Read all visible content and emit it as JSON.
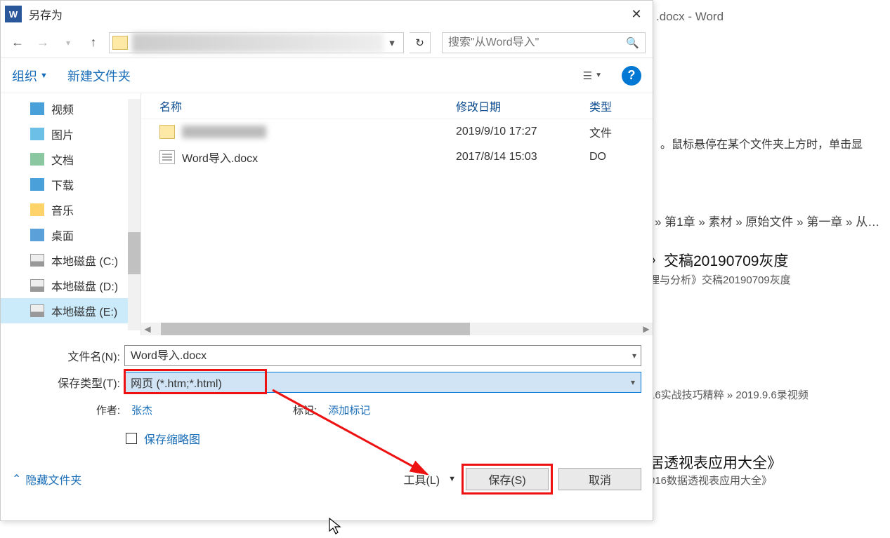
{
  "bg": {
    "winTitle": ".docx  -  Word",
    "hint": "。鼠标悬停在某个文件夹上方时，单击显",
    "path1": "» 第1章 » 素材 » 原始文件 » 第一章 » 从…",
    "head1": "〉交稿20190709灰度",
    "sub1": "理与分析》交稿20190709灰度",
    "path2": "16实战技巧精粹 » 2019.9.6录视频",
    "head2": "居透视表应用大全》",
    "sub2": "016数据透视表应用大全》"
  },
  "dialog": {
    "title": "另存为",
    "organize": "组织",
    "newFolder": "新建文件夹",
    "searchPlaceholder": "搜索\"从Word导入\"",
    "columns": {
      "name": "名称",
      "modified": "修改日期",
      "type": "类型"
    },
    "sidebar": [
      "视频",
      "图片",
      "文档",
      "下载",
      "音乐",
      "桌面",
      "本地磁盘 (C:)",
      "本地磁盘 (D:)",
      "本地磁盘 (E:)"
    ],
    "files": [
      {
        "name": "",
        "blurred": true,
        "date": "2019/9/10 17:27",
        "type": "文件",
        "isFolder": true
      },
      {
        "name": "Word导入.docx",
        "blurred": false,
        "date": "2017/8/14 15:03",
        "type": "DO",
        "isFolder": false
      }
    ],
    "fileNameLabel": "文件名(N):",
    "fileNameValue": "Word导入.docx",
    "saveTypeLabel": "保存类型(T):",
    "saveTypeValue": "网页 (*.htm;*.html)",
    "authorLabel": "作者:",
    "authorValue": "张杰",
    "tagLabel": "标记:",
    "tagValue": "添加标记",
    "saveThumb": "保存缩略图",
    "hideFolders": "隐藏文件夹",
    "tools": "工具(L)",
    "save": "保存(S)",
    "cancel": "取消"
  }
}
